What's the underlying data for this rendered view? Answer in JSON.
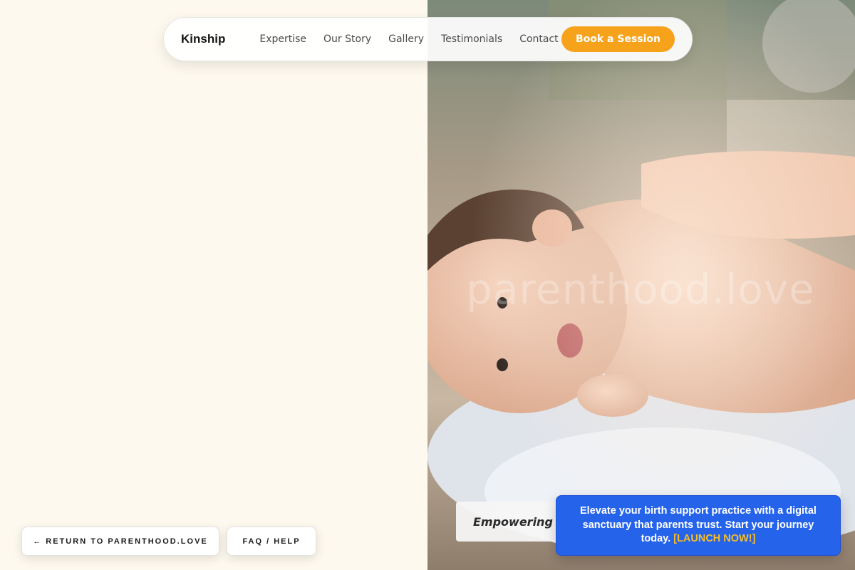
{
  "nav": {
    "brand": "Kinship",
    "links": [
      "Expertise",
      "Our Story",
      "Gallery",
      "Testimonials",
      "Contact"
    ],
    "cta_label": "Book a Session"
  },
  "hero": {
    "watermark": "parenthood.love",
    "caption": "Empowering Ev",
    "image_subject": "newborn baby lying on a blanket with an adult hand on its back"
  },
  "footer_buttons": {
    "return_label": "← RETURN TO PARENTHOOD.LOVE",
    "faq_label": "FAQ / HELP"
  },
  "promo": {
    "text": "Elevate your birth support practice with a digital sanctuary that parents trust. Start your journey today.",
    "link_label": "[LAUNCH NOW!]"
  },
  "colors": {
    "background": "#fef9ee",
    "accent": "#f7a21b",
    "promo_bg": "#2563eb",
    "promo_link": "#fbbf24"
  }
}
